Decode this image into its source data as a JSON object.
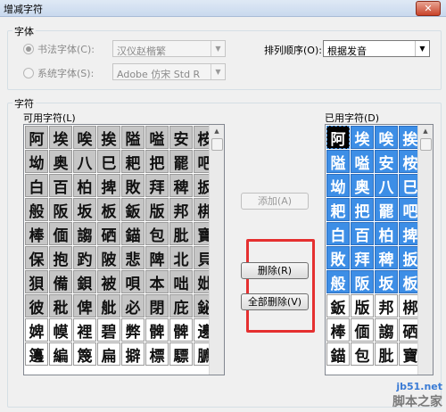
{
  "window": {
    "title": "增减字符",
    "close_glyph": "✕"
  },
  "font_group": {
    "label": "字体",
    "calligraphy_radio": "书法字体(C):",
    "calligraphy_value": "汉仪赵楷繁",
    "system_radio": "系统字体(S):",
    "system_value": "Adobe 仿宋 Std R",
    "sort_label": "排列顺序(O):",
    "sort_value": "根据发音"
  },
  "chars_group": {
    "label": "字符",
    "available_label": "可用字符(L)",
    "used_label": "已用字符(D)",
    "available": [
      "阿",
      "埃",
      "唉",
      "挨",
      "隘",
      "嗌",
      "安",
      "桉",
      "坳",
      "奥",
      "八",
      "巳",
      "耙",
      "把",
      "罷",
      "吧",
      "白",
      "百",
      "柏",
      "捭",
      "敗",
      "拜",
      "稗",
      "扳",
      "般",
      "阪",
      "坂",
      "板",
      "鈑",
      "版",
      "邦",
      "梆",
      "棒",
      "偭",
      "謅",
      "硒",
      "錨",
      "包",
      "肶",
      "寶",
      "保",
      "抱",
      "趵",
      "陂",
      "悲",
      "陴",
      "北",
      "貝",
      "狽",
      "備",
      "鋇",
      "被",
      "唄",
      "本",
      "咄",
      "妣",
      "彼",
      "秕",
      "俾",
      "舭",
      "必",
      "閉",
      "庇",
      "鉍",
      "婢",
      "幙",
      "裡",
      "碧",
      "弊",
      "髀",
      "髀",
      "邊",
      "籩",
      "編",
      "篾",
      "扁",
      "擗",
      "標",
      "驃",
      "臕"
    ],
    "available_plain_from": 64,
    "used": [
      "阿",
      "埃",
      "唉",
      "挨",
      "隘",
      "嗌",
      "安",
      "桉",
      "坳",
      "奥",
      "八",
      "巳",
      "耙",
      "把",
      "罷",
      "吧",
      "白",
      "百",
      "柏",
      "捭",
      "敗",
      "拜",
      "稗",
      "扳",
      "般",
      "阪",
      "坂",
      "板",
      "鈑",
      "版",
      "邦",
      "梆",
      "棒",
      "偭",
      "謅",
      "硒",
      "錨",
      "包",
      "肶",
      "寶"
    ],
    "used_selected_count": 28
  },
  "buttons": {
    "add": "添加(A)",
    "delete": "删除(R)",
    "delete_all": "全部删除(V)"
  },
  "watermark": {
    "url": "jb51.net",
    "name": "脚本之家"
  }
}
